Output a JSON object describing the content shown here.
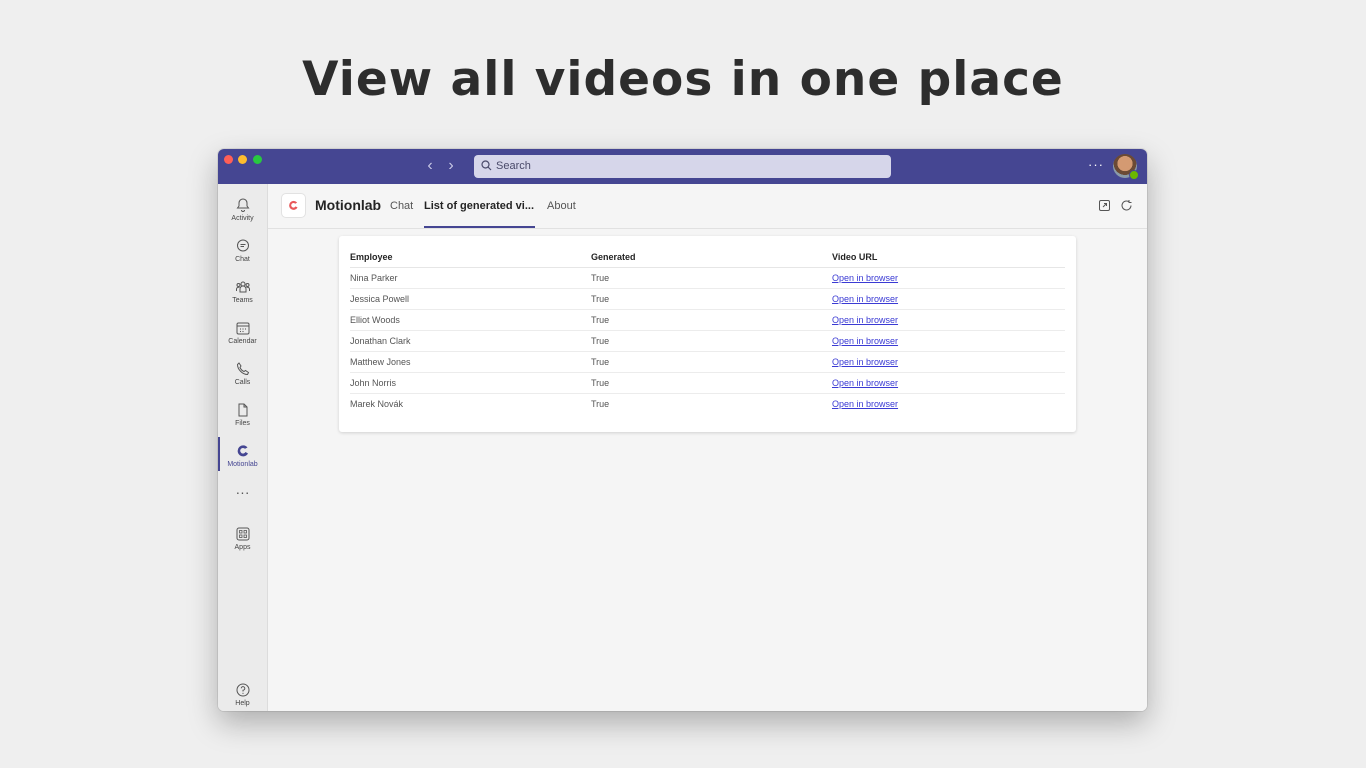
{
  "headline": "View all videos in one place",
  "search": {
    "placeholder": "Search"
  },
  "rail": {
    "items": [
      {
        "label": "Activity",
        "icon": "bell-icon"
      },
      {
        "label": "Chat",
        "icon": "chat-icon"
      },
      {
        "label": "Teams",
        "icon": "teams-icon"
      },
      {
        "label": "Calendar",
        "icon": "calendar-icon"
      },
      {
        "label": "Calls",
        "icon": "phone-icon"
      },
      {
        "label": "Files",
        "icon": "file-icon"
      },
      {
        "label": "Motionlab",
        "icon": "motionlab-icon"
      },
      {
        "label": "Apps",
        "icon": "apps-icon"
      },
      {
        "label": "Help",
        "icon": "help-icon"
      }
    ],
    "more": "···"
  },
  "app": {
    "name": "Motionlab",
    "tabs": [
      {
        "label": "Chat"
      },
      {
        "label": "List of generated vi..."
      },
      {
        "label": "About"
      }
    ]
  },
  "table": {
    "headers": [
      "Employee",
      "Generated",
      "Video URL"
    ],
    "rows": [
      {
        "employee": "Nina Parker",
        "generated": "True",
        "url": "Open in browser"
      },
      {
        "employee": "Jessica Powell",
        "generated": "True",
        "url": "Open in browser"
      },
      {
        "employee": "Elliot Woods",
        "generated": "True",
        "url": "Open in browser"
      },
      {
        "employee": "Jonathan Clark",
        "generated": "True",
        "url": "Open in browser"
      },
      {
        "employee": "Matthew Jones",
        "generated": "True",
        "url": "Open in browser"
      },
      {
        "employee": "John Norris",
        "generated": "True",
        "url": "Open in browser"
      },
      {
        "employee": "Marek Novák",
        "generated": "True",
        "url": "Open in browser"
      }
    ]
  },
  "colors": {
    "titlebar": "#454692",
    "accent": "#454692",
    "link": "#3a3ad4",
    "background": "#efefef"
  }
}
